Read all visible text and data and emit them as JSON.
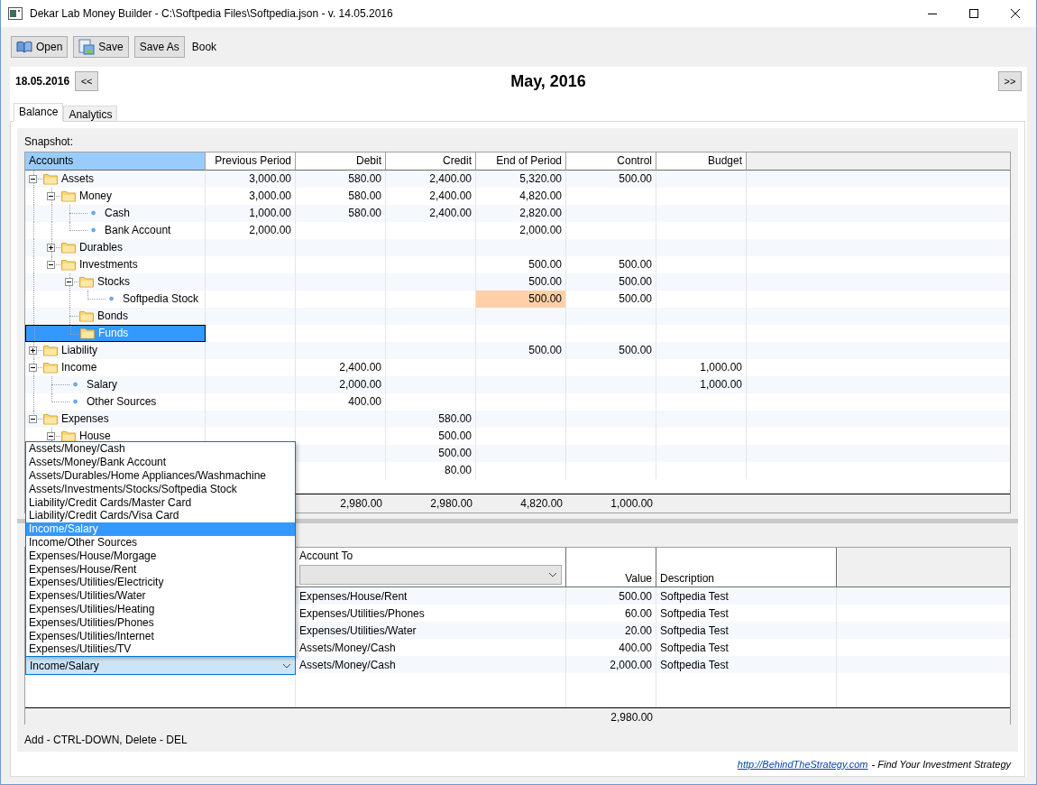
{
  "window": {
    "title": "Dekar Lab Money Builder - C:\\Softpedia Files\\Softpedia.json - v. 14.05.2016"
  },
  "toolbar": {
    "buttons": [
      {
        "label": "Open",
        "kind": "open"
      },
      {
        "label": "Save",
        "kind": "save"
      },
      {
        "label": "Save As",
        "kind": "text"
      }
    ],
    "book_label": "Book"
  },
  "period_bar": {
    "date": "18.05.2016",
    "prev": "<<",
    "title": "May, 2016",
    "next": ">>"
  },
  "tabs": [
    {
      "label": "Balance",
      "selected": true
    },
    {
      "label": "Analytics",
      "selected": false
    }
  ],
  "snapshot": {
    "label": "Snapshot:",
    "columns": [
      {
        "label": "Accounts",
        "selected": true
      },
      {
        "label": "Previous Period",
        "selected": false
      },
      {
        "label": "Debit",
        "selected": false
      },
      {
        "label": "Credit",
        "selected": false
      },
      {
        "label": "End of Period",
        "selected": false
      },
      {
        "label": "Control",
        "selected": false
      },
      {
        "label": "Budget",
        "selected": false
      }
    ],
    "rows": [
      {
        "name": "Assets",
        "kind": "folder",
        "expanded": true,
        "selected": false,
        "values": {
          "previous_period": "3,000.00",
          "debit": "580.00",
          "credit": "2,400.00",
          "end_of_period": "5,320.00",
          "control": "500.00"
        },
        "children": [
          {
            "name": "Money",
            "kind": "folder",
            "expanded": true,
            "selected": false,
            "values": {
              "previous_period": "3,000.00",
              "debit": "580.00",
              "credit": "2,400.00",
              "end_of_period": "4,820.00"
            },
            "children": [
              {
                "name": "Cash",
                "kind": "account",
                "selected": false,
                "values": {
                  "previous_period": "1,000.00",
                  "debit": "580.00",
                  "credit": "2,400.00",
                  "end_of_period": "2,820.00"
                }
              },
              {
                "name": "Bank Account",
                "kind": "account",
                "selected": false,
                "values": {
                  "previous_period": "2,000.00",
                  "end_of_period": "2,000.00"
                }
              }
            ]
          },
          {
            "name": "Durables",
            "kind": "folder",
            "expanded": false,
            "selected": false
          },
          {
            "name": "Investments",
            "kind": "folder",
            "expanded": true,
            "selected": false,
            "values": {
              "end_of_period": "500.00",
              "control": "500.00"
            },
            "children": [
              {
                "name": "Stocks",
                "kind": "folder",
                "expanded": true,
                "selected": false,
                "values": {
                  "end_of_period": "500.00",
                  "control": "500.00"
                },
                "children": [
                  {
                    "name": "Softpedia Stock",
                    "kind": "account",
                    "selected": false,
                    "values": {
                      "end_of_period": {
                        "text": "500.00",
                        "flagged": true
                      },
                      "control": "500.00"
                    }
                  }
                ]
              },
              {
                "name": "Bonds",
                "kind": "folder",
                "selected": false
              },
              {
                "name": "Funds",
                "kind": "folder",
                "selected": true
              }
            ]
          }
        ]
      },
      {
        "name": "Liability",
        "kind": "folder",
        "expanded": false,
        "selected": false,
        "values": {
          "end_of_period": "500.00",
          "control": "500.00"
        }
      },
      {
        "name": "Income",
        "kind": "folder",
        "expanded": true,
        "selected": false,
        "values": {
          "debit": "2,400.00",
          "budget": "1,000.00"
        },
        "children": [
          {
            "name": "Salary",
            "kind": "account",
            "selected": false,
            "values": {
              "debit": "2,000.00",
              "budget": "1,000.00"
            }
          },
          {
            "name": "Other Sources",
            "kind": "account",
            "selected": false,
            "values": {
              "debit": "400.00"
            }
          }
        ]
      },
      {
        "name": "Expenses",
        "kind": "folder",
        "expanded": true,
        "selected": false,
        "values": {
          "credit": "580.00"
        },
        "children": [
          {
            "name": "House",
            "kind": "folder",
            "expanded": true,
            "selected": false,
            "values": {
              "credit": "500.00"
            },
            "children": [
              {
                "values": {
                  "credit": "500.00"
                }
              }
            ]
          },
          {
            "values": {
              "credit": "80.00"
            }
          }
        ]
      }
    ],
    "totals": {
      "debit": "2,980.00",
      "credit": "2,980.00",
      "end_of_period": "4,820.00",
      "control": "1,000.00"
    }
  },
  "transactions": {
    "columns": [
      {
        "label": "Account To",
        "filter": true
      },
      {
        "label": "Value"
      },
      {
        "label": "Description"
      }
    ],
    "rows": [
      {
        "editing": false,
        "to": "Expenses/House/Rent",
        "value": "500.00",
        "description": "Softpedia Test"
      },
      {
        "editing": false,
        "to": "Expenses/Utilities/Phones",
        "value": "60.00",
        "description": "Softpedia Test"
      },
      {
        "editing": false,
        "to": "Expenses/Utilities/Water",
        "value": "20.00",
        "description": "Softpedia Test"
      },
      {
        "editing": false,
        "to": "Assets/Money/Cash",
        "value": "400.00",
        "description": "Softpedia Test"
      },
      {
        "editing": true,
        "from": "Income/Salary",
        "to": "Assets/Money/Cash",
        "value": "2,000.00",
        "description": "Softpedia Test"
      }
    ],
    "dropdown": [
      {
        "label": "Assets/Money/Cash",
        "selected": false
      },
      {
        "label": "Assets/Money/Bank Account",
        "selected": false
      },
      {
        "label": "Assets/Durables/Home Appliances/Washmachine",
        "selected": false
      },
      {
        "label": "Assets/Investments/Stocks/Softpedia Stock",
        "selected": false
      },
      {
        "label": "Liability/Credit Cards/Master Card",
        "selected": false
      },
      {
        "label": "Liability/Credit Cards/Visa Card",
        "selected": false
      },
      {
        "label": "Income/Salary",
        "selected": true
      },
      {
        "label": "Income/Other Sources",
        "selected": false
      },
      {
        "label": "Expenses/House/Morgage",
        "selected": false
      },
      {
        "label": "Expenses/House/Rent",
        "selected": false
      },
      {
        "label": "Expenses/Utilities/Electricity",
        "selected": false
      },
      {
        "label": "Expenses/Utilities/Water",
        "selected": false
      },
      {
        "label": "Expenses/Utilities/Heating",
        "selected": false
      },
      {
        "label": "Expenses/Utilities/Phones",
        "selected": false
      },
      {
        "label": "Expenses/Utilities/Internet",
        "selected": false
      },
      {
        "label": "Expenses/Utilities/TV",
        "selected": false
      }
    ],
    "total": "2,980.00"
  },
  "hint": "Add - CTRL-DOWN, Delete - DEL",
  "footer": {
    "link": "http://BehindTheStrategy.com",
    "tagline": "- Find Your Investment Strategy"
  }
}
